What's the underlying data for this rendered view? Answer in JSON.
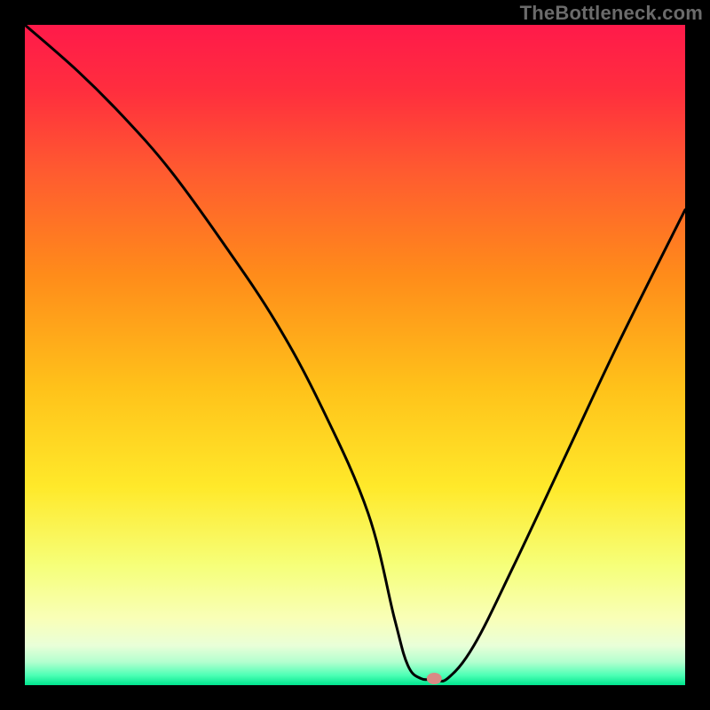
{
  "watermark": "TheBottleneck.com",
  "chart_data": {
    "type": "line",
    "title": "",
    "xlabel": "",
    "ylabel": "",
    "xlim": [
      0,
      100
    ],
    "ylim": [
      0,
      100
    ],
    "grid": false,
    "legend": false,
    "background": "rainbow-vertical",
    "series": [
      {
        "name": "bottleneck-curve",
        "x": [
          0,
          8,
          15,
          22,
          30,
          38,
          45,
          52,
          56,
          58,
          60,
          62,
          64,
          68,
          74,
          82,
          90,
          100
        ],
        "values": [
          100,
          93,
          86,
          78,
          67,
          55,
          42,
          26,
          10,
          3,
          1,
          1,
          1,
          6,
          18,
          35,
          52,
          72
        ]
      }
    ],
    "marker": {
      "x": 62,
      "y": 1
    },
    "gradient_stops": [
      {
        "offset": 0.0,
        "color": "#ff1a4a"
      },
      {
        "offset": 0.1,
        "color": "#ff2e3e"
      },
      {
        "offset": 0.22,
        "color": "#ff5a30"
      },
      {
        "offset": 0.38,
        "color": "#ff8c1a"
      },
      {
        "offset": 0.55,
        "color": "#ffc21a"
      },
      {
        "offset": 0.7,
        "color": "#ffe92a"
      },
      {
        "offset": 0.82,
        "color": "#f6ff7a"
      },
      {
        "offset": 0.9,
        "color": "#f9ffb8"
      },
      {
        "offset": 0.94,
        "color": "#e9ffd8"
      },
      {
        "offset": 0.965,
        "color": "#b3ffcf"
      },
      {
        "offset": 0.985,
        "color": "#4dffb5"
      },
      {
        "offset": 1.0,
        "color": "#00e58e"
      }
    ]
  }
}
